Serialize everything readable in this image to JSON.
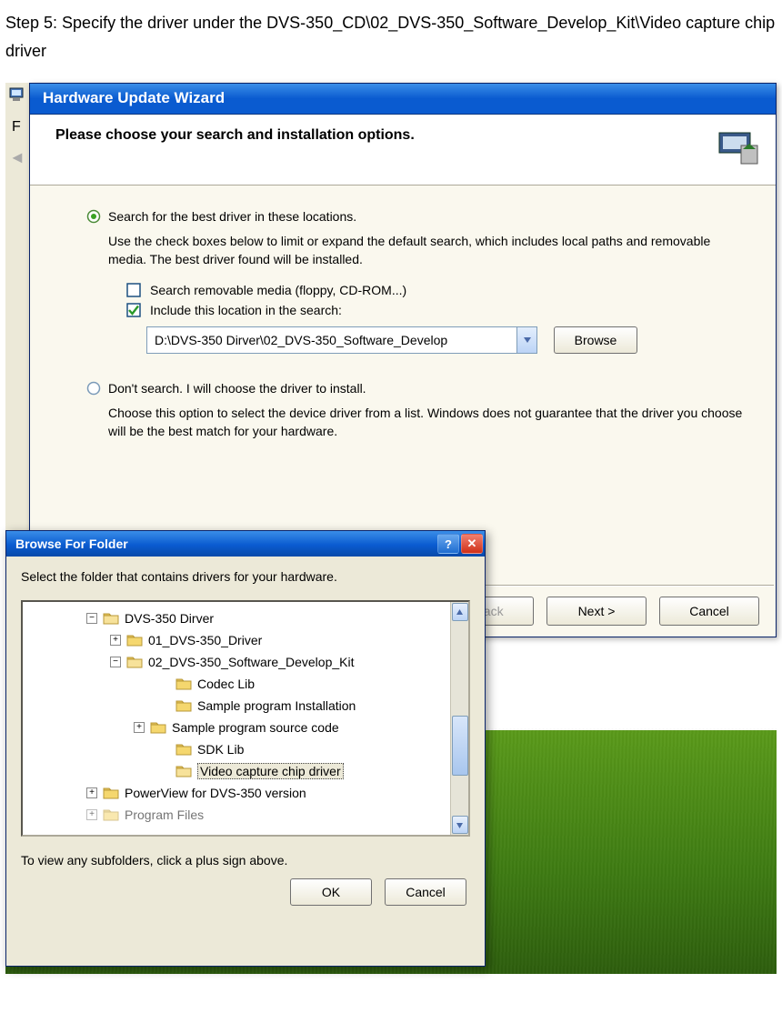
{
  "page": {
    "step_text": "Step 5: Specify the driver under the DVS-350_CD\\02_DVS-350_Software_Develop_Kit\\Video capture chip driver"
  },
  "bg": {
    "f_label": "F"
  },
  "wizard": {
    "title": "Hardware Update Wizard",
    "heading": "Please choose your search and installation options.",
    "opt1_label": "Search for the best driver in these locations.",
    "opt1_desc": "Use the check boxes below to limit or expand the default search, which includes local paths and removable media. The best driver found will be installed.",
    "chk1_label": "Search removable media (floppy, CD-ROM...)",
    "chk2_label": "Include this location in the search:",
    "chk1_checked": false,
    "chk2_checked": true,
    "path_value": "D:\\DVS-350 Dirver\\02_DVS-350_Software_Develop",
    "browse_btn": "Browse",
    "opt2_label": "Don't search. I will choose the driver to install.",
    "opt2_desc": "Choose this option to select the device driver from a list.  Windows does not guarantee that the driver you choose will be the best match for your hardware.",
    "back_btn": "< Back",
    "next_btn": "Next >",
    "cancel_btn": "Cancel"
  },
  "browse": {
    "title": "Browse For Folder",
    "prompt": "Select the folder that contains drivers for your hardware.",
    "hint": "To view any subfolders, click a plus sign above.",
    "ok_btn": "OK",
    "cancel_btn": "Cancel",
    "tree": [
      {
        "indent": 70,
        "toggle": "-",
        "label": "DVS-350 Dirver"
      },
      {
        "indent": 96,
        "toggle": "+",
        "label": "01_DVS-350_Driver"
      },
      {
        "indent": 96,
        "toggle": "-",
        "label": "02_DVS-350_Software_Develop_Kit"
      },
      {
        "indent": 150,
        "toggle": "",
        "label": "Codec Lib"
      },
      {
        "indent": 150,
        "toggle": "",
        "label": "Sample program Installation"
      },
      {
        "indent": 122,
        "toggle": "+",
        "label": "Sample program source code"
      },
      {
        "indent": 150,
        "toggle": "",
        "label": "SDK Lib"
      },
      {
        "indent": 150,
        "toggle": "",
        "label": "Video capture chip driver",
        "selected": true
      },
      {
        "indent": 70,
        "toggle": "+",
        "label": "PowerView for DVS-350 version"
      },
      {
        "indent": 70,
        "toggle": "+",
        "label": "Program Files",
        "cut": true
      }
    ]
  }
}
